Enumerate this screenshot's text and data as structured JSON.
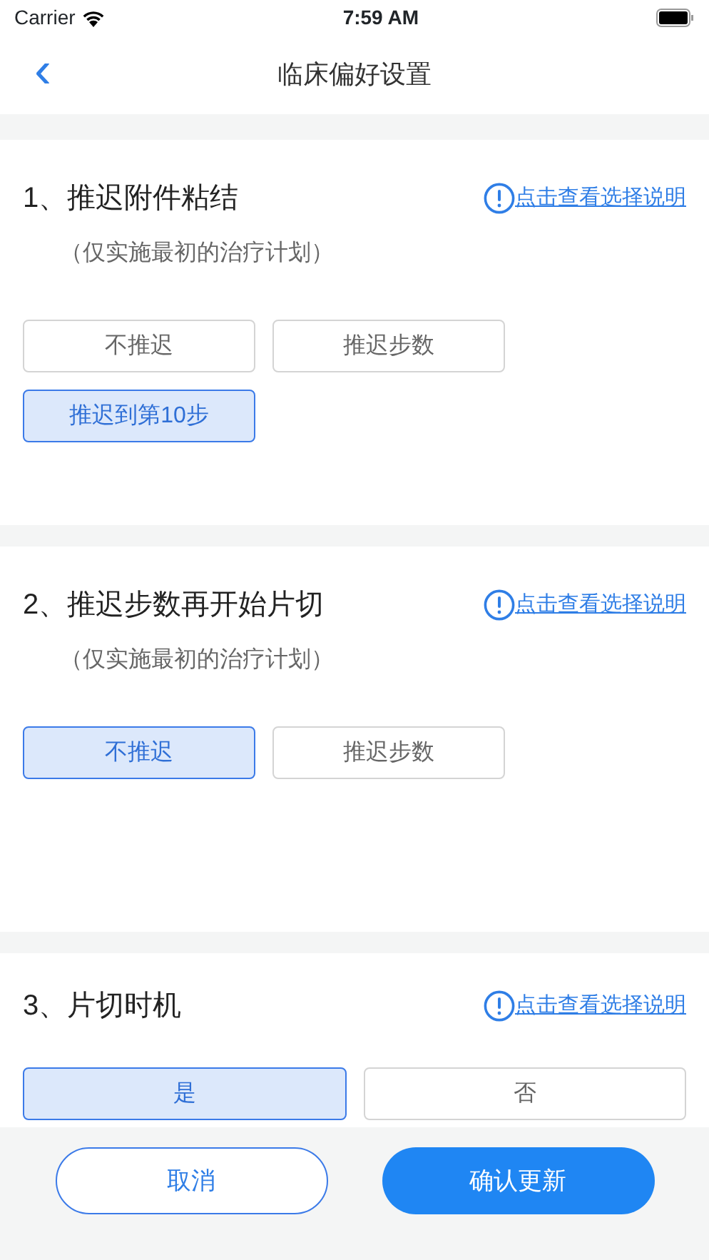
{
  "status_bar": {
    "carrier": "Carrier",
    "time": "7:59 AM"
  },
  "nav": {
    "back": "‹",
    "title": "临床偏好设置"
  },
  "sections": [
    {
      "kind": "grid",
      "title": "1、推迟附件粘结",
      "link": "点击查看选择说明",
      "subtitle": "（仅实施最初的治疗计划）",
      "options": [
        {
          "label": "不推迟",
          "selected": false
        },
        {
          "label": "推迟步数",
          "selected": false
        },
        {
          "label": "推迟到第10步",
          "selected": true
        }
      ]
    },
    {
      "kind": "grid",
      "title": "2、推迟步数再开始片切",
      "link": "点击查看选择说明",
      "subtitle": "（仅实施最初的治疗计划）",
      "options": [
        {
          "label": "不推迟",
          "selected": true
        },
        {
          "label": "推迟步数",
          "selected": false
        }
      ]
    },
    {
      "kind": "wide",
      "title": "3、片切时机",
      "link": "点击查看选择说明",
      "options": [
        {
          "label": "是",
          "selected": true
        },
        {
          "label": "否",
          "selected": false
        }
      ]
    }
  ],
  "footer": {
    "cancel": "取消",
    "confirm": "确认更新"
  }
}
